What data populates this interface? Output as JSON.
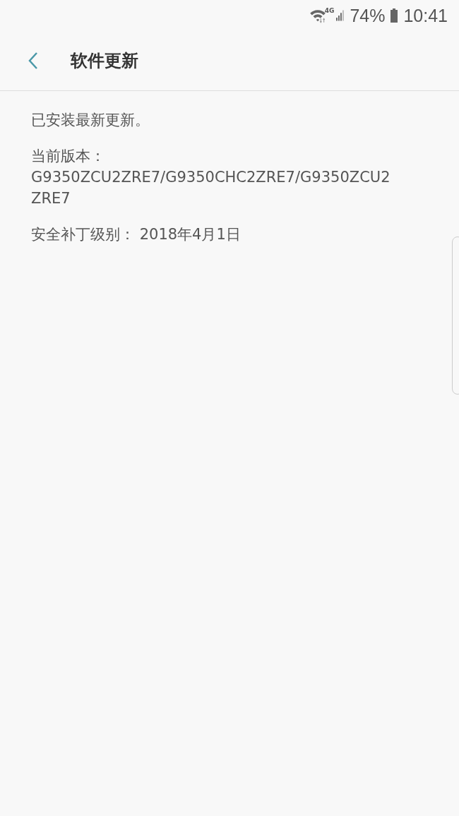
{
  "status_bar": {
    "battery": "74%",
    "time": "10:41",
    "network": "4G"
  },
  "header": {
    "title": "软件更新"
  },
  "info": [
    "已安装最新更新。",
    "当前版本：G9350ZCU2ZRE7/G9350CHC2ZRE7/G9350ZCU2ZRE7",
    "安全补丁级别： 2018年4月1日"
  ]
}
